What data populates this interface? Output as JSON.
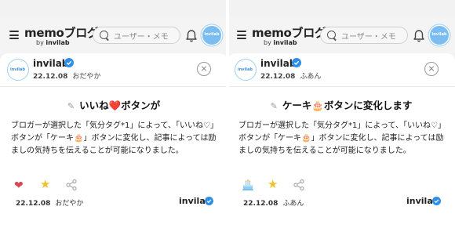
{
  "panels": [
    {
      "header": {
        "logo_text": "memoブログ",
        "logo_by": "by ",
        "logo_brand": "invilab",
        "search_placeholder": "ユーザー・メモ",
        "avatar_text": "invilab"
      },
      "author": {
        "name": "invilab",
        "date": "22.12.08",
        "mood": "おだやか",
        "avatar_text": "invilab"
      },
      "title": "いいね❤️ボタンが",
      "body": "ブロガーが選択した「気分タグ*1」によって、「いいね♡」ボタンが「ケーキ🎂」ボタンに変化し、記事によっては励ましの気持ちを伝えることが可能になりました。",
      "reaction_icon": "heart-icon",
      "footer": {
        "date": "22.12.08",
        "mood": "おだやか",
        "brand": "invilab"
      }
    },
    {
      "header": {
        "logo_text": "memoブログ",
        "logo_by": "by ",
        "logo_brand": "invilab",
        "search_placeholder": "ユーザー・メモ",
        "avatar_text": "invilab"
      },
      "author": {
        "name": "invilab",
        "date": "22.12.08",
        "mood": "ふあん",
        "avatar_text": "invilab"
      },
      "title": "ケーキ🎂ボタンに変化します",
      "body": "ブロガーが選択した「気分タグ*1」によって、「いいね♡」ボタンが「ケーキ🎂」ボタンに変化し、記事によっては励ましの気持ちを伝えることが可能になりました。",
      "reaction_icon": "cake-icon",
      "footer": {
        "date": "22.12.08",
        "mood": "ふあん",
        "brand": "invilab"
      }
    }
  ],
  "colors": {
    "accent_blue": "#2f8fe6",
    "heart": "#d94754",
    "star": "#efc12e",
    "cake": "#8fcdf2"
  }
}
